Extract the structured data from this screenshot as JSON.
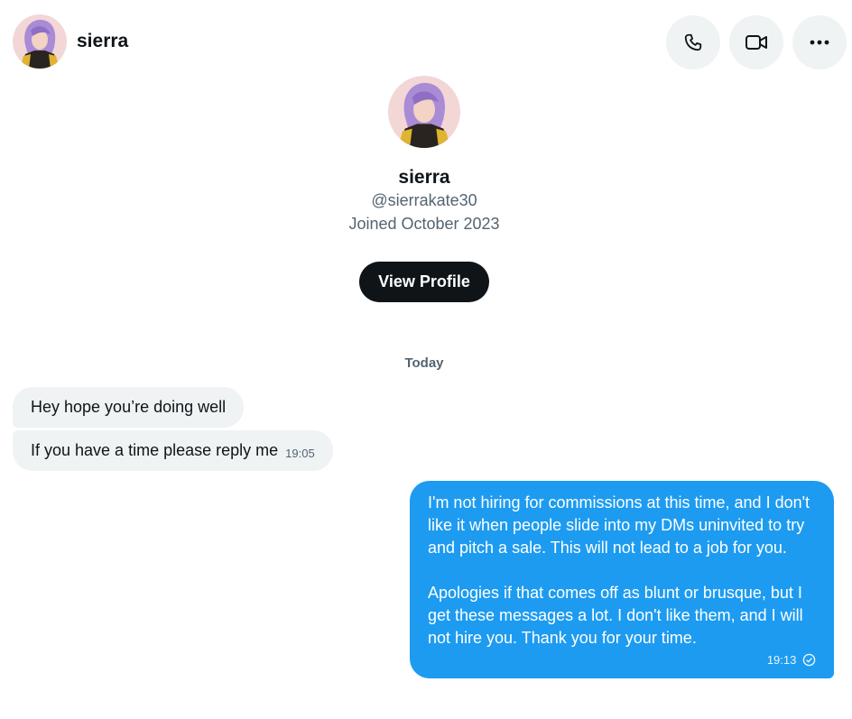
{
  "header": {
    "name": "sierra",
    "avatar_icon": "user-avatar"
  },
  "actions": {
    "call_icon": "phone-icon",
    "video_icon": "video-camera-icon",
    "more_icon": "more-horizontal-icon"
  },
  "profile": {
    "name": "sierra",
    "handle": "@sierrakate30",
    "joined": "Joined October 2023",
    "view_profile_label": "View Profile"
  },
  "conversation": {
    "day_label": "Today",
    "incoming": [
      {
        "text": "Hey hope you’re doing well",
        "time": ""
      },
      {
        "text": "If you have a time please reply me",
        "time": "19:05"
      }
    ],
    "outgoing": {
      "paragraph1": "I'm not hiring for commissions at this time, and I don't like it when people slide into my DMs uninvited to try and pitch a sale. This will not lead to a job for you.",
      "paragraph2": "Apologies if that comes off as blunt or brusque, but I get these messages a lot. I don't like them, and I will not hire you. Thank you for your time.",
      "time": "19:13",
      "status_icon": "sent-check-icon"
    }
  },
  "colors": {
    "accent": "#1d9bf0",
    "bubble_in": "#eff3f4",
    "button_dark": "#0f1419",
    "muted": "#536471"
  }
}
